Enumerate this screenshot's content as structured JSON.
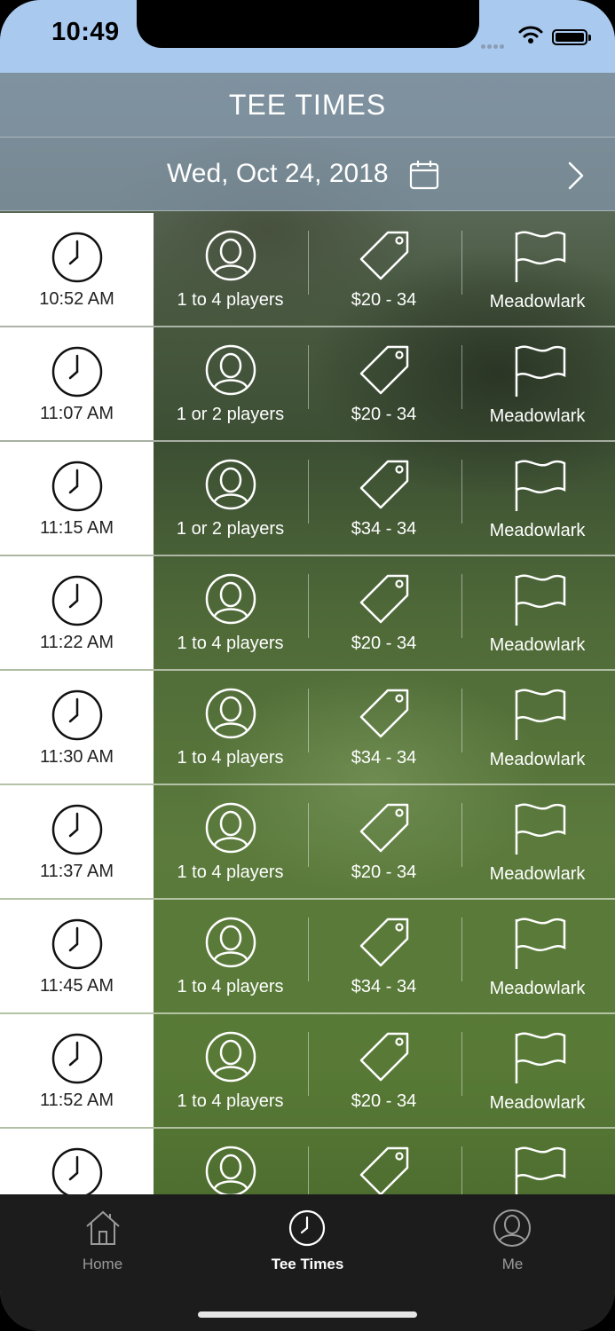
{
  "status": {
    "time": "10:49"
  },
  "header": {
    "title": "TEE TIMES"
  },
  "date_bar": {
    "date": "Wed, Oct 24, 2018"
  },
  "tee_times": [
    {
      "time": "10:52 AM",
      "players": "1 to 4 players",
      "price": "$20 - 34",
      "course": "Meadowlark"
    },
    {
      "time": "11:07 AM",
      "players": "1 or 2 players",
      "price": "$20 - 34",
      "course": "Meadowlark"
    },
    {
      "time": "11:15 AM",
      "players": "1 or 2 players",
      "price": "$34 - 34",
      "course": "Meadowlark"
    },
    {
      "time": "11:22 AM",
      "players": "1 to 4 players",
      "price": "$20 - 34",
      "course": "Meadowlark"
    },
    {
      "time": "11:30 AM",
      "players": "1 to 4 players",
      "price": "$34 - 34",
      "course": "Meadowlark"
    },
    {
      "time": "11:37 AM",
      "players": "1 to 4 players",
      "price": "$20 - 34",
      "course": "Meadowlark"
    },
    {
      "time": "11:45 AM",
      "players": "1 to 4 players",
      "price": "$34 - 34",
      "course": "Meadowlark"
    },
    {
      "time": "11:52 AM",
      "players": "1 to 4 players",
      "price": "$20 - 34",
      "course": "Meadowlark"
    },
    {
      "time": "",
      "players": "",
      "price": "",
      "course": ""
    }
  ],
  "tabs": [
    {
      "label": "Home",
      "icon": "home-icon",
      "active": false
    },
    {
      "label": "Tee Times",
      "icon": "clock-icon",
      "active": true
    },
    {
      "label": "Me",
      "icon": "person-icon",
      "active": false
    }
  ],
  "colors": {
    "status_bar": "#a9c9ee",
    "header": "#8296aa",
    "tab_bar": "#1c1c1c",
    "tab_active": "#ffffff",
    "tab_inactive": "#9a9a9a"
  }
}
